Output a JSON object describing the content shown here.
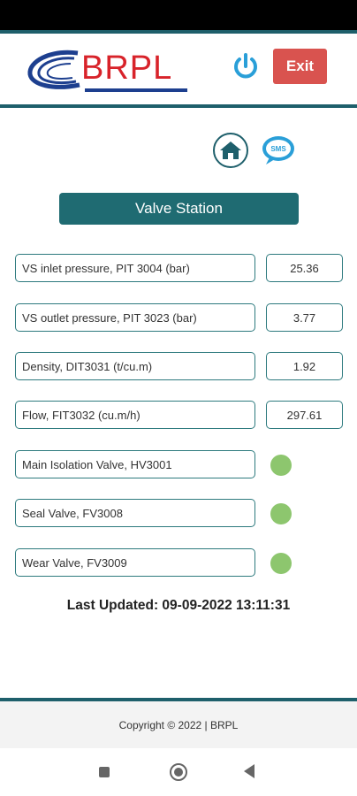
{
  "header": {
    "logo_text": "BRPL",
    "exit_label": "Exit"
  },
  "page": {
    "title": "Valve Station",
    "last_updated": "Last Updated: 09-09-2022 13:11:31"
  },
  "readings": [
    {
      "label": "VS inlet pressure, PIT 3004 (bar)",
      "value": "25.36"
    },
    {
      "label": "VS outlet pressure, PIT 3023 (bar)",
      "value": "3.77"
    },
    {
      "label": "Density, DIT3031 (t/cu.m)",
      "value": "1.92"
    },
    {
      "label": "Flow, FIT3032 (cu.m/h)",
      "value": "297.61"
    }
  ],
  "valves": [
    {
      "label": "Main Isolation Valve, HV3001",
      "status_color": "#8dc66e"
    },
    {
      "label": "Seal Valve, FV3008",
      "status_color": "#8dc66e"
    },
    {
      "label": "Wear Valve, FV3009",
      "status_color": "#8dc66e"
    }
  ],
  "footer": {
    "copyright": "Copyright © 2022 | BRPL"
  },
  "icons": {
    "power": "power-icon",
    "home": "home-icon",
    "sms": "sms-icon",
    "nav_recents": "square-icon",
    "nav_home": "circle-icon",
    "nav_back": "triangle-back-icon"
  },
  "colors": {
    "primary": "#1f6b72",
    "exit": "#d9534f",
    "brand_red": "#d8232a",
    "brand_blue": "#1d3f8f",
    "power_blue": "#2a9fd8",
    "status_on": "#8dc66e"
  }
}
